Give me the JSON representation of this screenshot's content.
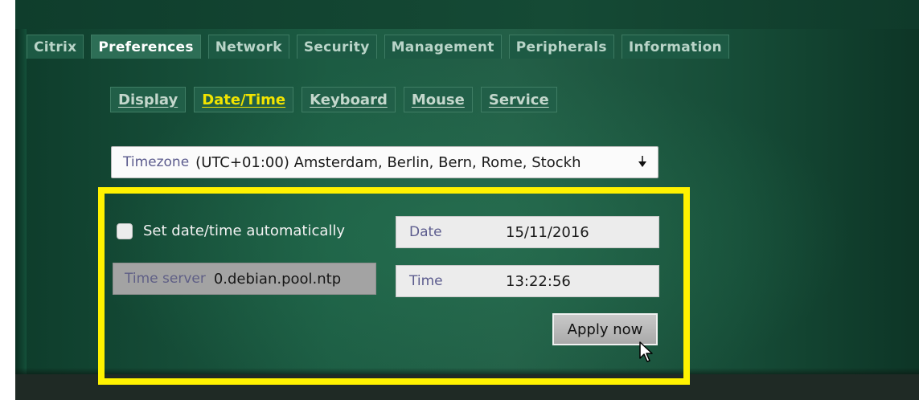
{
  "main_tabs": [
    {
      "label": "Citrix"
    },
    {
      "label": "Preferences",
      "active": true
    },
    {
      "label": "Network"
    },
    {
      "label": "Security"
    },
    {
      "label": "Management"
    },
    {
      "label": "Peripherals"
    },
    {
      "label": "Information"
    }
  ],
  "sub_tabs": [
    {
      "label": "Display"
    },
    {
      "label": "Date/Time",
      "active": true
    },
    {
      "label": "Keyboard"
    },
    {
      "label": "Mouse"
    },
    {
      "label": "Service"
    }
  ],
  "timezone": {
    "label": "Timezone",
    "value": "(UTC+01:00) Amsterdam, Berlin, Bern, Rome, Stockh"
  },
  "datetime": {
    "auto_label": "Set date/time automatically",
    "auto_checked": false,
    "date_label": "Date",
    "date_value": "15/11/2016",
    "time_label": "Time",
    "time_value": "13:22:56",
    "server_label": "Time server",
    "server_value": "0.debian.pool.ntp",
    "apply_label": "Apply now"
  },
  "colors": {
    "highlight": "#fff200",
    "active_subtab": "#f2e400",
    "panel_green": "#1c5c43"
  },
  "icons": {
    "dropdown": "dropdown-arrow-icon",
    "cursor": "mouse-pointer-icon"
  }
}
